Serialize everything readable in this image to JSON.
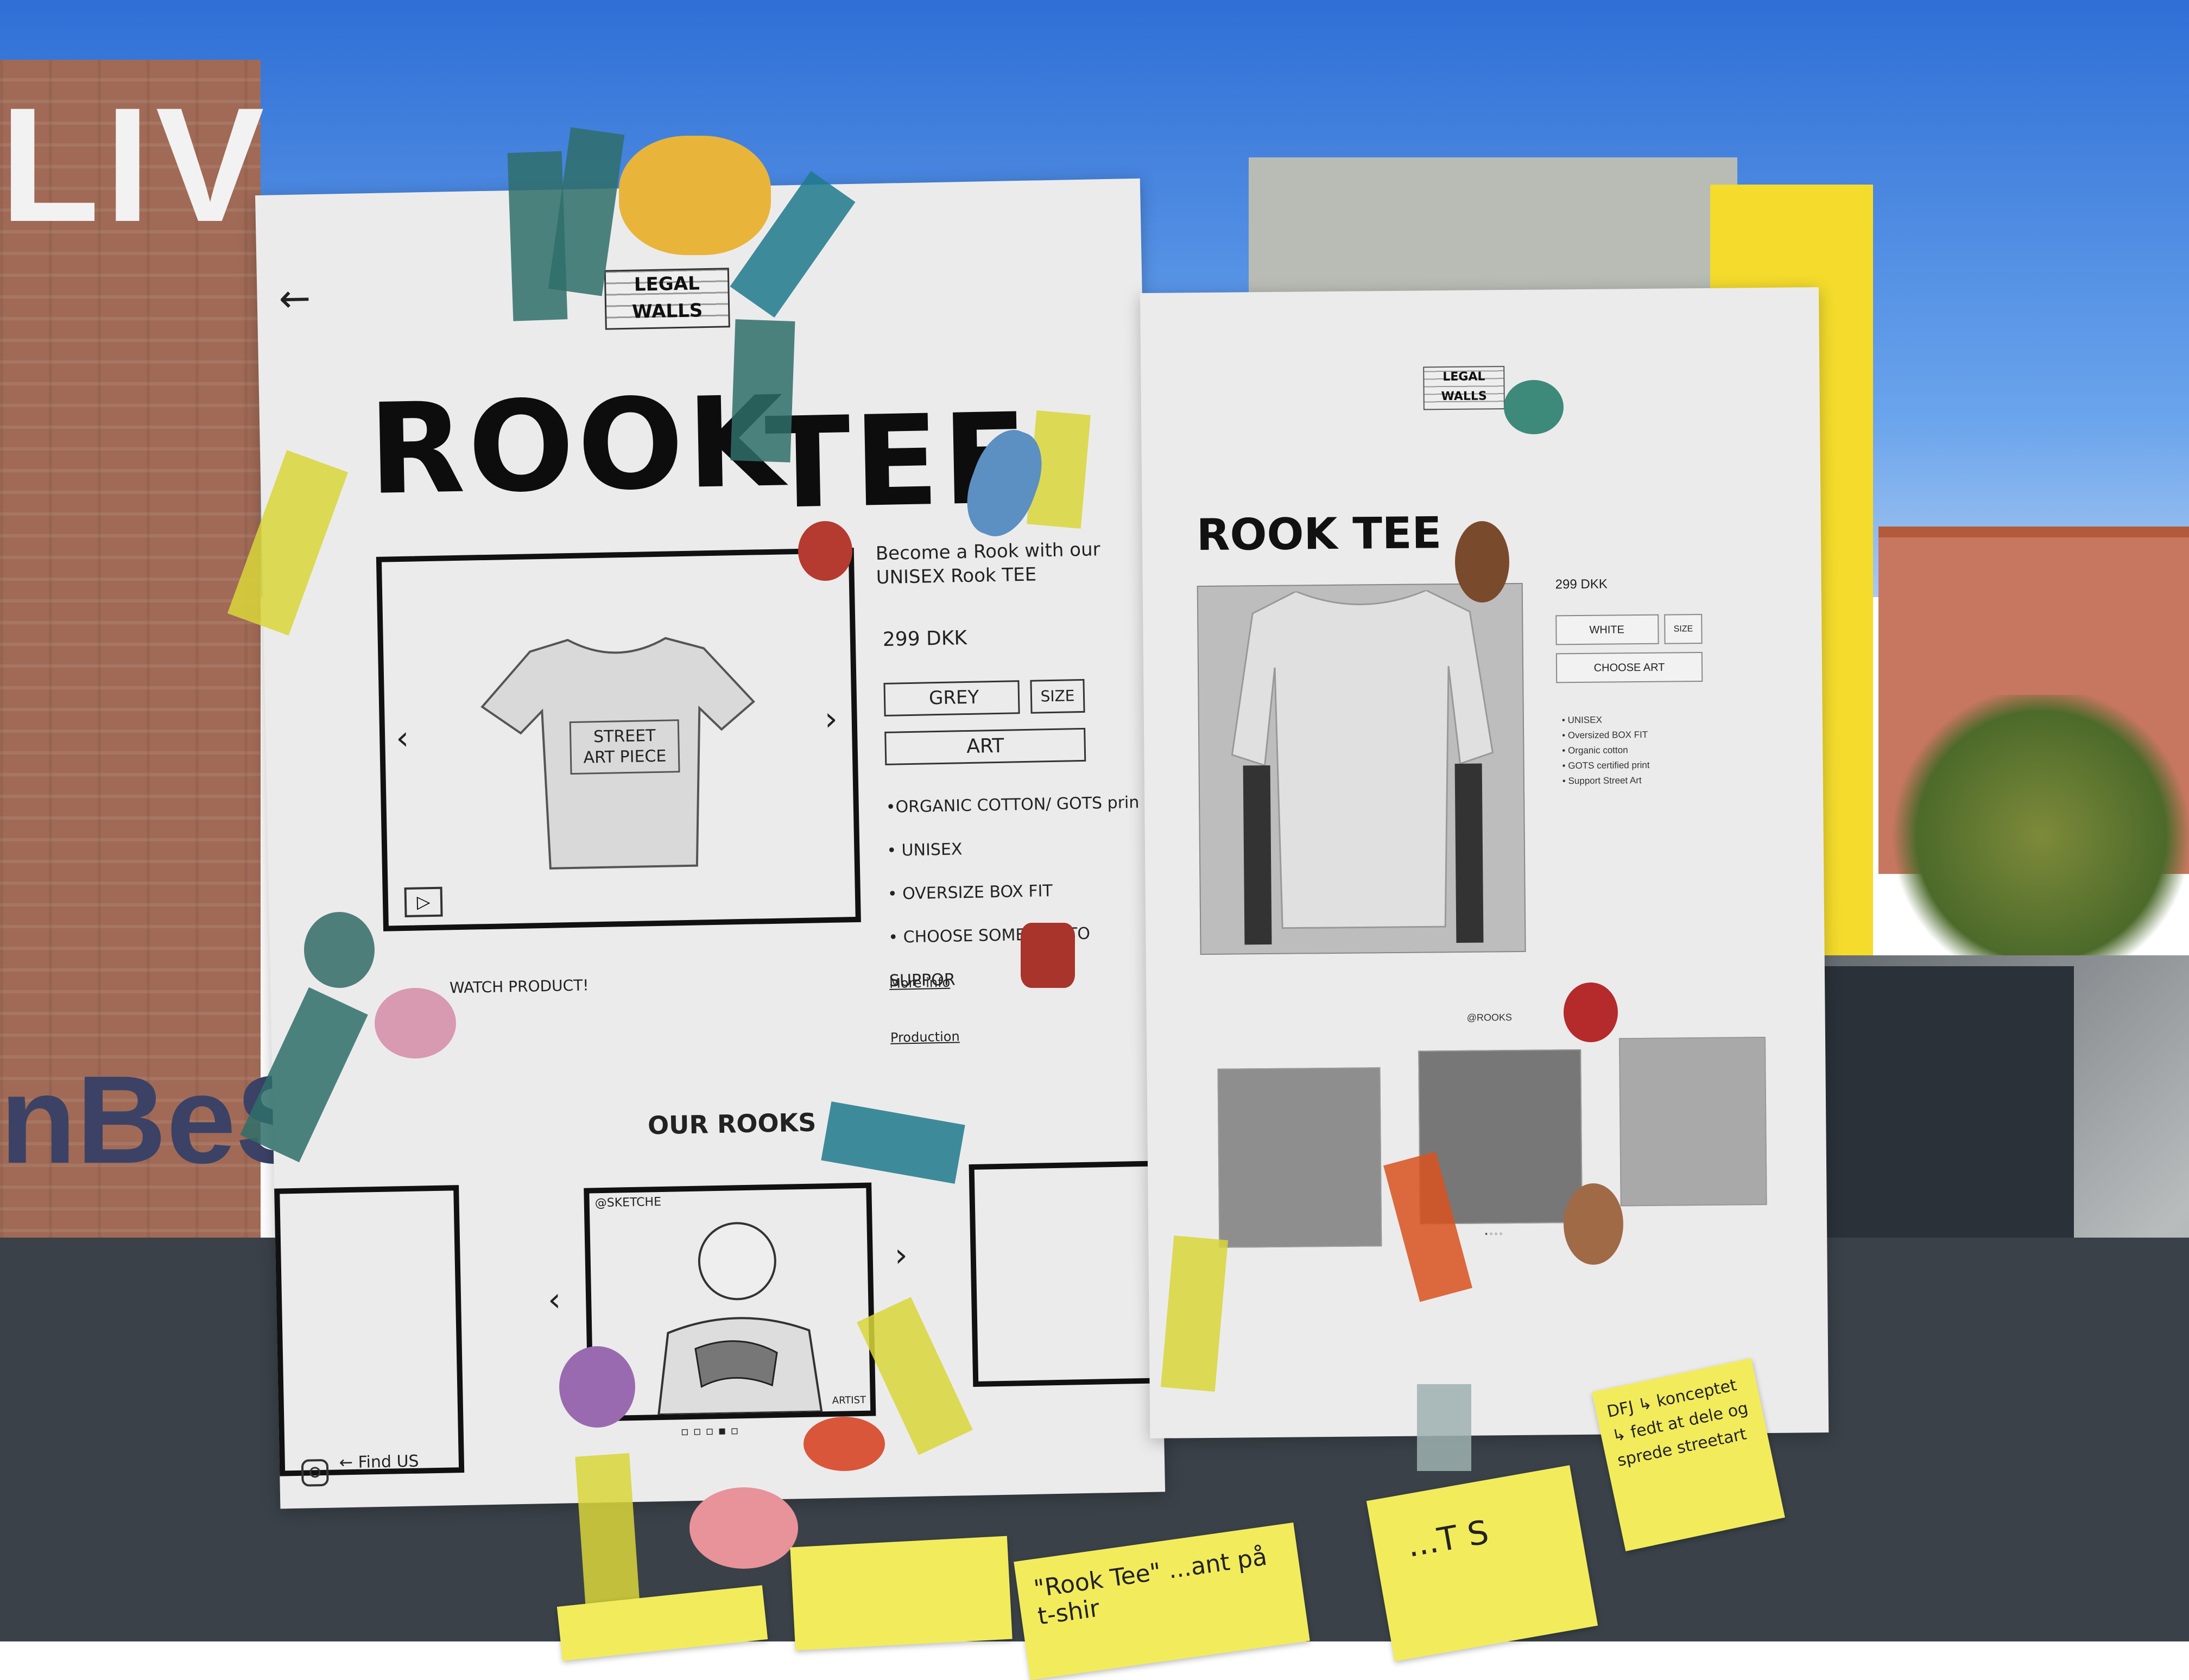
{
  "background": {
    "wall_text": "LIV",
    "graffiti_text": "nBeS"
  },
  "left_sketch": {
    "back_arrow": "←",
    "logo": "LEGAL WALLS",
    "title_word1": "ROOK",
    "title_word2": "TEE",
    "shirt_print": "STREET ART PIECE",
    "tagline": "Become a Rook with our UNISEX Rook TEE",
    "price": "299 DKK",
    "color_select": "GREY",
    "size_select": "SIZE",
    "art_button": "ART",
    "features": [
      "•ORGANIC COTTON/ GOTS prin",
      "• UNISEX",
      "• OVERSIZE BOX FIT",
      "• CHOOSE SOME ART TO SUPPOR"
    ],
    "link_more": "More info",
    "link_production": "Production",
    "watch_label": "WATCH PRODUCT!",
    "section_title": "OUR ROOKS",
    "carousel_handle": "@SKETCHE",
    "carousel_artist": "ARTIST",
    "find_us": "Find US"
  },
  "right_print": {
    "logo": "LEGAL WALLS",
    "title": "ROOK TEE",
    "price": "299 DKK",
    "color_select": "WHITE",
    "size_select": "SIZE",
    "art_button": "CHOOSE ART",
    "features": [
      "• UNISEX",
      "• Oversized BOX FIT",
      "• Organic cotton",
      "• GOTS certified print",
      "• Support Street Art"
    ],
    "handle": "@ROOKS"
  },
  "sticky_notes": {
    "note1": "DFJ ↳ konceptet ↳ fedt at dele og sprede streetart",
    "note2": "\"Rook Tee\" ...ant på t-shir",
    "note3": "...T S"
  },
  "colors": {
    "tape_teal": "#2f6f6a",
    "tape_yellow": "#d9d63a",
    "tape_blue": "#1f7a8c",
    "tape_orange": "#d8521e",
    "note_yellow": "#f2ec5c"
  }
}
